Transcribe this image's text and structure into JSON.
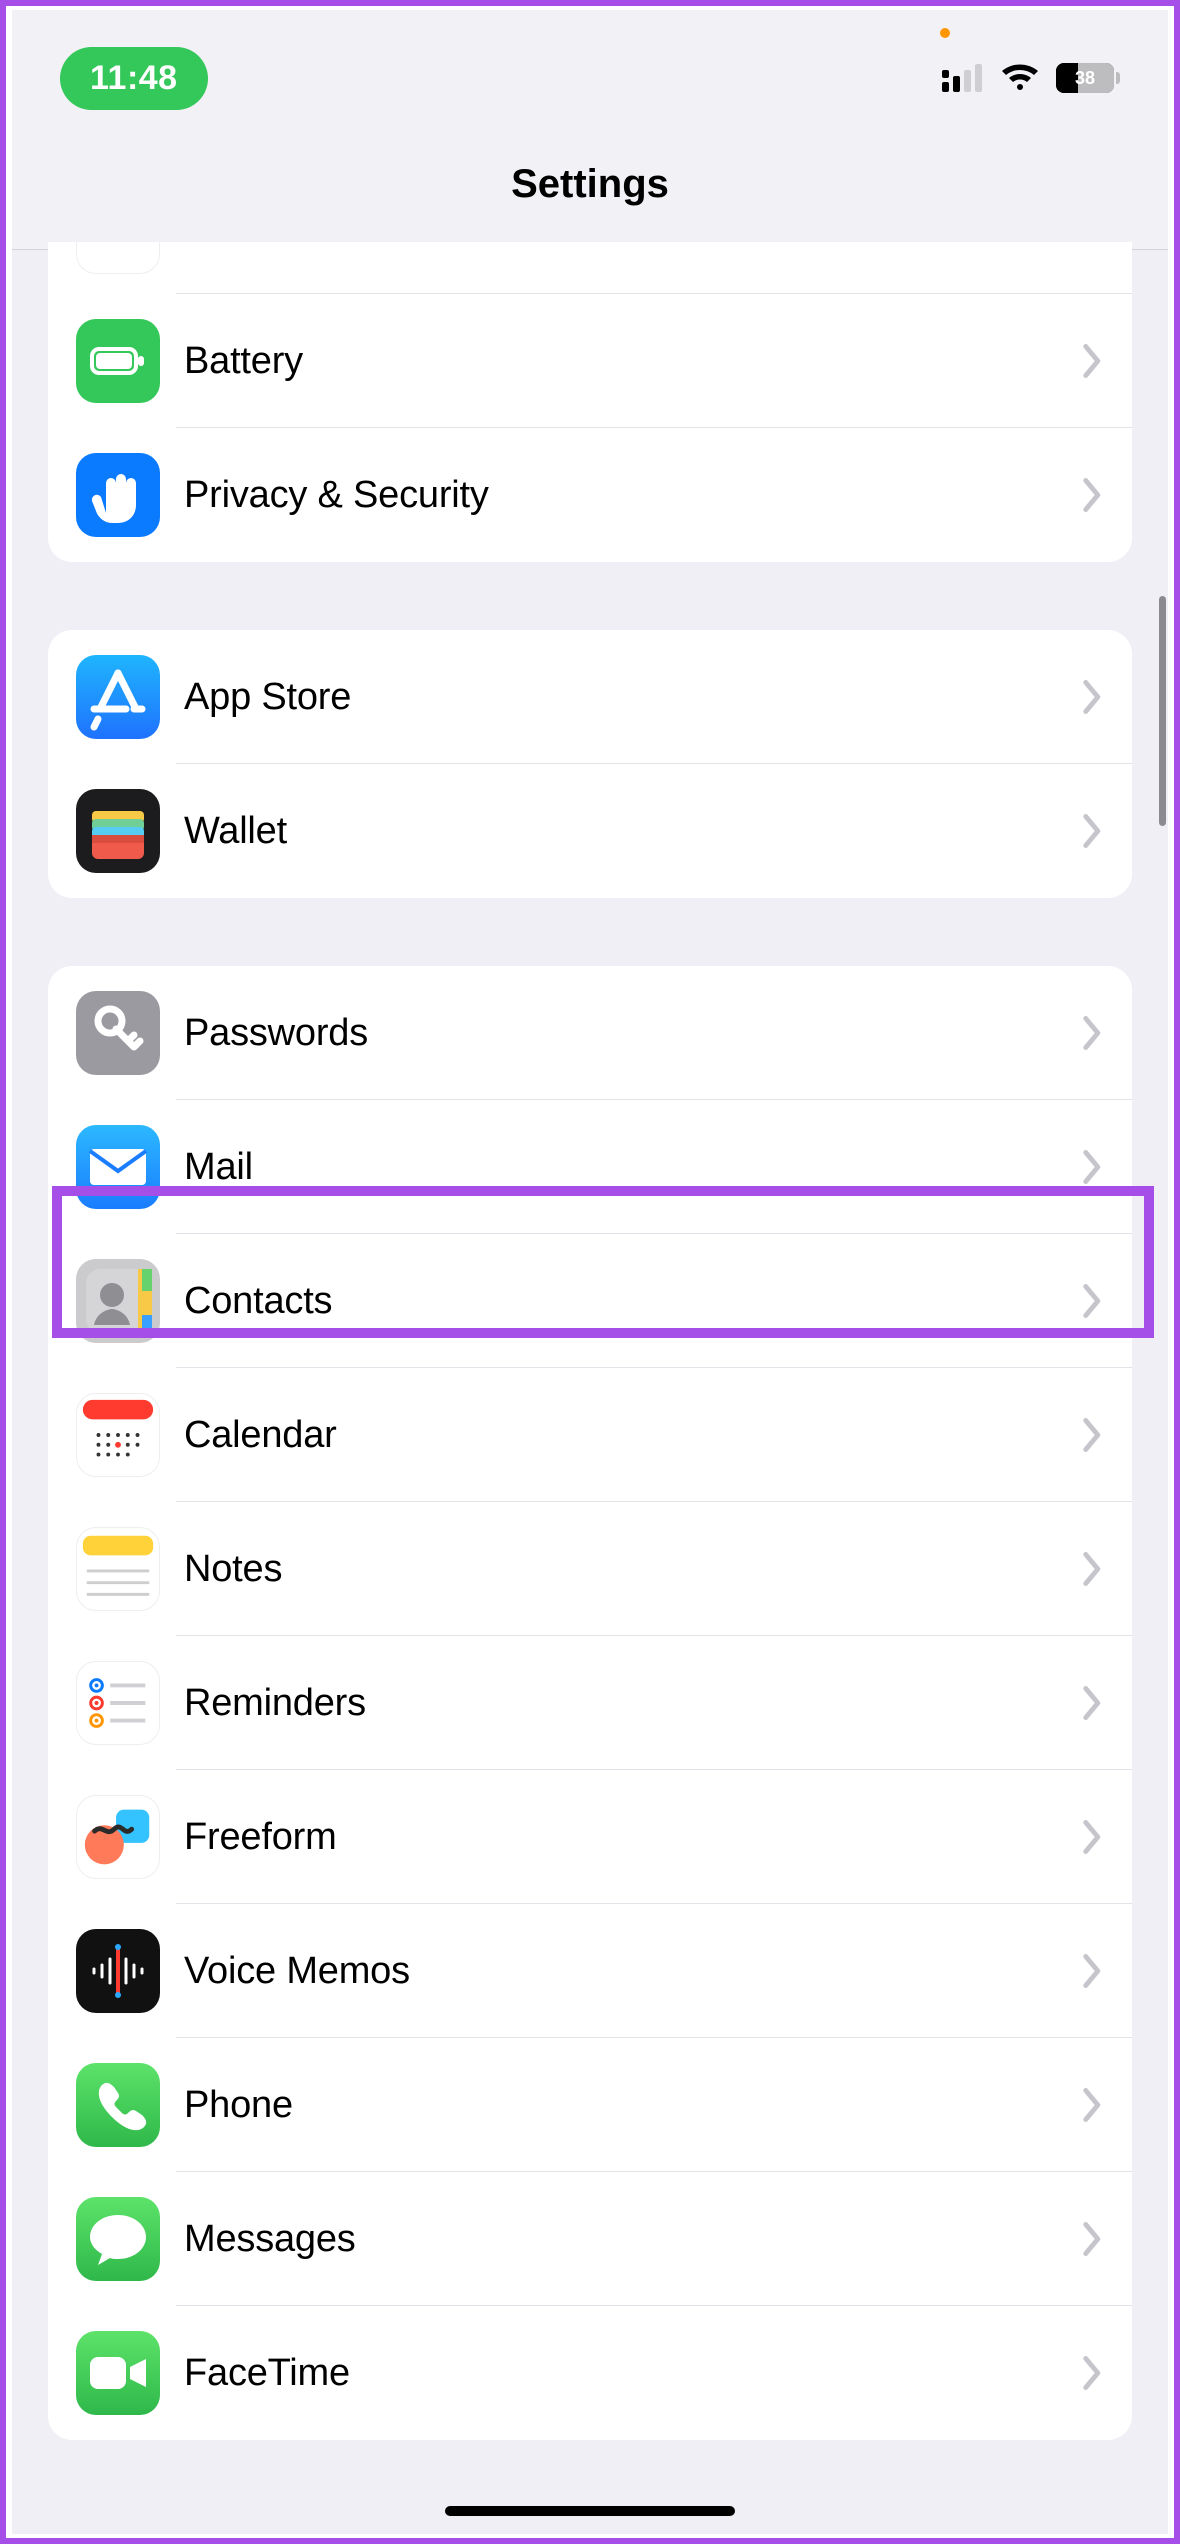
{
  "status": {
    "time": "11:48",
    "battery_pct": "38"
  },
  "header": {
    "title": "Settings"
  },
  "groups": [
    {
      "rows": [
        {
          "id": "battery",
          "label": "Battery"
        },
        {
          "id": "privacy",
          "label": "Privacy & Security"
        }
      ]
    },
    {
      "rows": [
        {
          "id": "appstore",
          "label": "App Store"
        },
        {
          "id": "wallet",
          "label": "Wallet"
        }
      ]
    },
    {
      "rows": [
        {
          "id": "passwords",
          "label": "Passwords"
        },
        {
          "id": "mail",
          "label": "Mail"
        },
        {
          "id": "contacts",
          "label": "Contacts"
        },
        {
          "id": "calendar",
          "label": "Calendar"
        },
        {
          "id": "notes",
          "label": "Notes"
        },
        {
          "id": "reminders",
          "label": "Reminders"
        },
        {
          "id": "freeform",
          "label": "Freeform"
        },
        {
          "id": "voicememos",
          "label": "Voice Memos"
        },
        {
          "id": "phone",
          "label": "Phone"
        },
        {
          "id": "messages",
          "label": "Messages"
        },
        {
          "id": "facetime",
          "label": "FaceTime"
        }
      ]
    }
  ],
  "highlighted_row_id": "mail",
  "icons": {
    "battery": "battery-icon",
    "privacy": "privacy-hand-icon",
    "appstore": "app-store-icon",
    "wallet": "wallet-icon",
    "passwords": "passwords-key-icon",
    "mail": "mail-envelope-icon",
    "contacts": "contacts-icon",
    "calendar": "calendar-icon",
    "notes": "notes-icon",
    "reminders": "reminders-icon",
    "freeform": "freeform-icon",
    "voicememos": "voice-memos-icon",
    "phone": "phone-icon",
    "messages": "messages-icon",
    "facetime": "facetime-icon"
  }
}
